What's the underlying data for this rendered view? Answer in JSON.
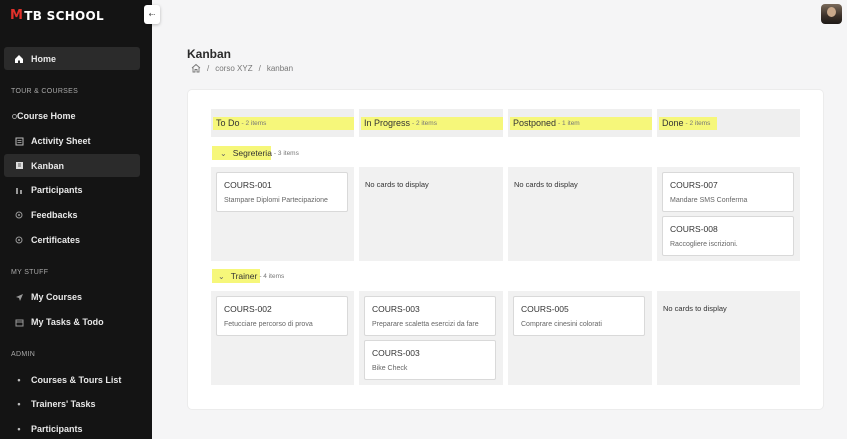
{
  "brand": {
    "logo_mark": "M",
    "logo_text": "TB SCHOOL",
    "accent": "#e0302a"
  },
  "toggle_icon": "arrow-left-icon",
  "sidebar": {
    "home": "Home",
    "section_tour": "TOUR & COURSES",
    "tour_items": [
      "Course Home",
      "Activity Sheet",
      "Kanban",
      "Participants",
      "Feedbacks",
      "Certificates"
    ],
    "section_stuff": "MY STUFF",
    "stuff_items": [
      "My Courses",
      "My Tasks & Todo"
    ],
    "section_admin": "ADMIN",
    "admin_items": [
      "Courses & Tours List",
      "Trainers' Tasks",
      "Participants"
    ]
  },
  "header": {
    "title": "Kanban",
    "breadcrumb": [
      "corso XYZ",
      "kanban"
    ],
    "separator": "/"
  },
  "columns": [
    {
      "title": "To Do",
      "count": "- 2 items"
    },
    {
      "title": "In Progress",
      "count": "- 2 items"
    },
    {
      "title": "Postponed",
      "count": "- 1 item"
    },
    {
      "title": "Done",
      "count": "- 2 items"
    }
  ],
  "empty_text": "No cards to display",
  "lanes": [
    {
      "title": "Segreteria",
      "count": "- 3 items",
      "cells": [
        [
          {
            "id": "COURS-001",
            "desc": "Stampare Diplomi Partecipazione"
          }
        ],
        [],
        [],
        [
          {
            "id": "COURS-007",
            "desc": "Mandare SMS Conferma"
          },
          {
            "id": "COURS-008",
            "desc": "Raccogliere iscrizioni."
          }
        ]
      ]
    },
    {
      "title": "Trainer",
      "count": "- 4 items",
      "cells": [
        [
          {
            "id": "COURS-002",
            "desc": "Fetucciare percorso di prova"
          }
        ],
        [
          {
            "id": "COURS-003",
            "desc": "Preparare scaletta esercizi da fare"
          },
          {
            "id": "COURS-003",
            "desc": "Bike Check"
          }
        ],
        [
          {
            "id": "COURS-005",
            "desc": "Comprare cinesini colorati"
          }
        ],
        []
      ]
    }
  ],
  "highlight_color": "#f6f77a"
}
